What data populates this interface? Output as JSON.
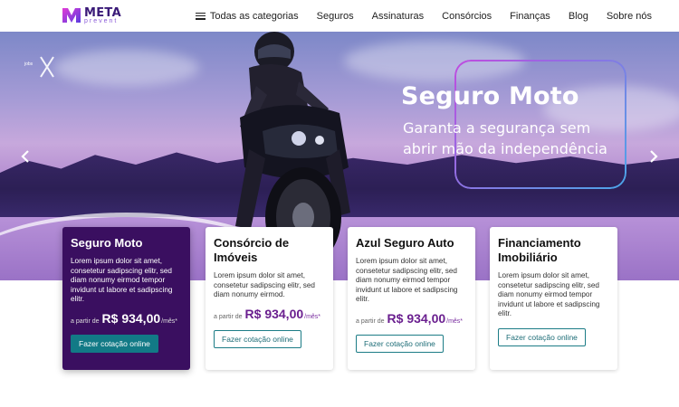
{
  "brand": {
    "name": "META",
    "sub": "prevent"
  },
  "nav": {
    "categories": "Todas as categorias",
    "items": [
      "Seguros",
      "Assinaturas",
      "Consórcios",
      "Finanças",
      "Blog",
      "Sobre nós"
    ]
  },
  "hero": {
    "badge": "jobs",
    "title": "Seguro Moto",
    "subtitle": "Garanta a segurança sem abrir mão da independência"
  },
  "cards": [
    {
      "title": "Seguro Moto",
      "desc": "Lorem ipsum dolor sit amet, consetetur sadipscing elitr, sed diam nonumy eirmod tempor invidunt ut labore et sadipscing elitr.",
      "price_prefix": "a partir de",
      "price": "R$ 934,00",
      "price_suffix": "/mês*",
      "button": "Fazer cotação online",
      "active": true
    },
    {
      "title": "Consórcio de Imóveis",
      "desc": "Lorem ipsum dolor sit amet, consetetur sadipscing elitr, sed diam nonumy eirmod.",
      "price_prefix": "a partir de",
      "price": "R$ 934,00",
      "price_suffix": "/mês*",
      "button": "Fazer cotação online",
      "active": false
    },
    {
      "title": "Azul Seguro Auto",
      "desc": "Lorem ipsum dolor sit amet, consetetur sadipscing elitr, sed diam nonumy eirmod tempor invidunt ut labore et sadipscing elitr.",
      "price_prefix": "a partir de",
      "price": "R$ 934,00",
      "price_suffix": "/mês*",
      "button": "Fazer cotação online",
      "active": false
    },
    {
      "title": "Financiamento Imobiliário",
      "desc": "Lorem ipsum dolor sit amet, consetetur sadipscing elitr, sed diam nonumy eirmod tempor invidunt ut labore et sadipscing elitr.",
      "price_prefix": "",
      "price": "",
      "price_suffix": "",
      "button": "Fazer cotação online",
      "active": false
    }
  ],
  "colors": {
    "brand_purple": "#3a0f60",
    "accent_teal": "#127a86",
    "price_purple": "#6a1f8f"
  },
  "icons": {
    "menu": "hamburger-icon",
    "prev": "chevron-left-icon",
    "next": "chevron-right-icon"
  }
}
